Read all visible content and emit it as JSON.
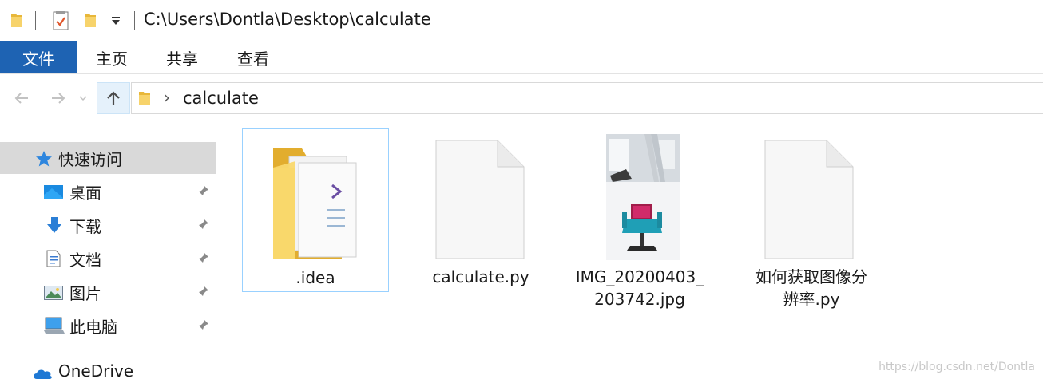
{
  "title_bar": {
    "path": "C:\\Users\\Dontla\\Desktop\\calculate"
  },
  "ribbon": {
    "tabs": [
      {
        "label": "文件",
        "active": true
      },
      {
        "label": "主页"
      },
      {
        "label": "共享"
      },
      {
        "label": "查看"
      }
    ]
  },
  "address_bar": {
    "breadcrumb_separator": "›",
    "current_folder": "calculate"
  },
  "nav_pane": {
    "items": [
      {
        "label": "快速访问",
        "icon": "star-icon",
        "selected": true
      },
      {
        "label": "桌面",
        "icon": "desktop-icon",
        "pinned": true
      },
      {
        "label": "下载",
        "icon": "download-icon",
        "pinned": true
      },
      {
        "label": "文档",
        "icon": "document-icon",
        "pinned": true
      },
      {
        "label": "图片",
        "icon": "pictures-icon",
        "pinned": true
      },
      {
        "label": "此电脑",
        "icon": "computer-icon",
        "pinned": true
      },
      {
        "label": "OneDrive",
        "icon": "cloud-icon"
      }
    ]
  },
  "files": [
    {
      "name": ".idea",
      "type": "folder",
      "selected": true
    },
    {
      "name": "calculate.py",
      "type": "file"
    },
    {
      "name_line1": "IMG_20200403_",
      "name_line2": "203742.jpg",
      "type": "image"
    },
    {
      "name_line1": "如何获取图像分",
      "name_line2": "辨率.py",
      "type": "file"
    }
  ],
  "watermark": "https://blog.csdn.net/Dontla",
  "colors": {
    "file_tab_bg": "#1e63b3",
    "selection_bg": "#d9d9d9",
    "tile_selected_border": "#99d1ff",
    "folder_yellow": "#f5c842"
  }
}
